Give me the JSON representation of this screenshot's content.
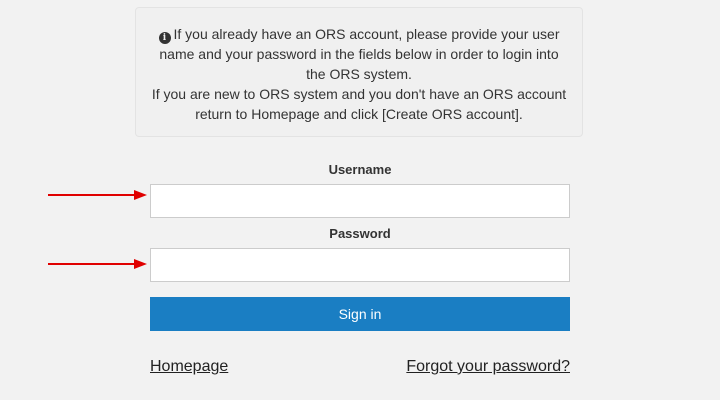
{
  "info": {
    "icon": "info-circle-icon",
    "line1": "If you already have an ORS account, please provide your user name and your password in the fields below in order to login into the ORS system.",
    "line2": "If you are new to ORS system and you don't have an ORS account return to Homepage and click [Create ORS account]."
  },
  "form": {
    "username_label": "Username",
    "username_value": "",
    "password_label": "Password",
    "password_value": "",
    "signin_label": "Sign in"
  },
  "links": {
    "homepage": "Homepage",
    "forgot_password": "Forgot your password?"
  },
  "annotations": {
    "arrow_color": "#e00000"
  },
  "colors": {
    "primary_button": "#1a7ec3",
    "background": "#f2f2f2"
  }
}
